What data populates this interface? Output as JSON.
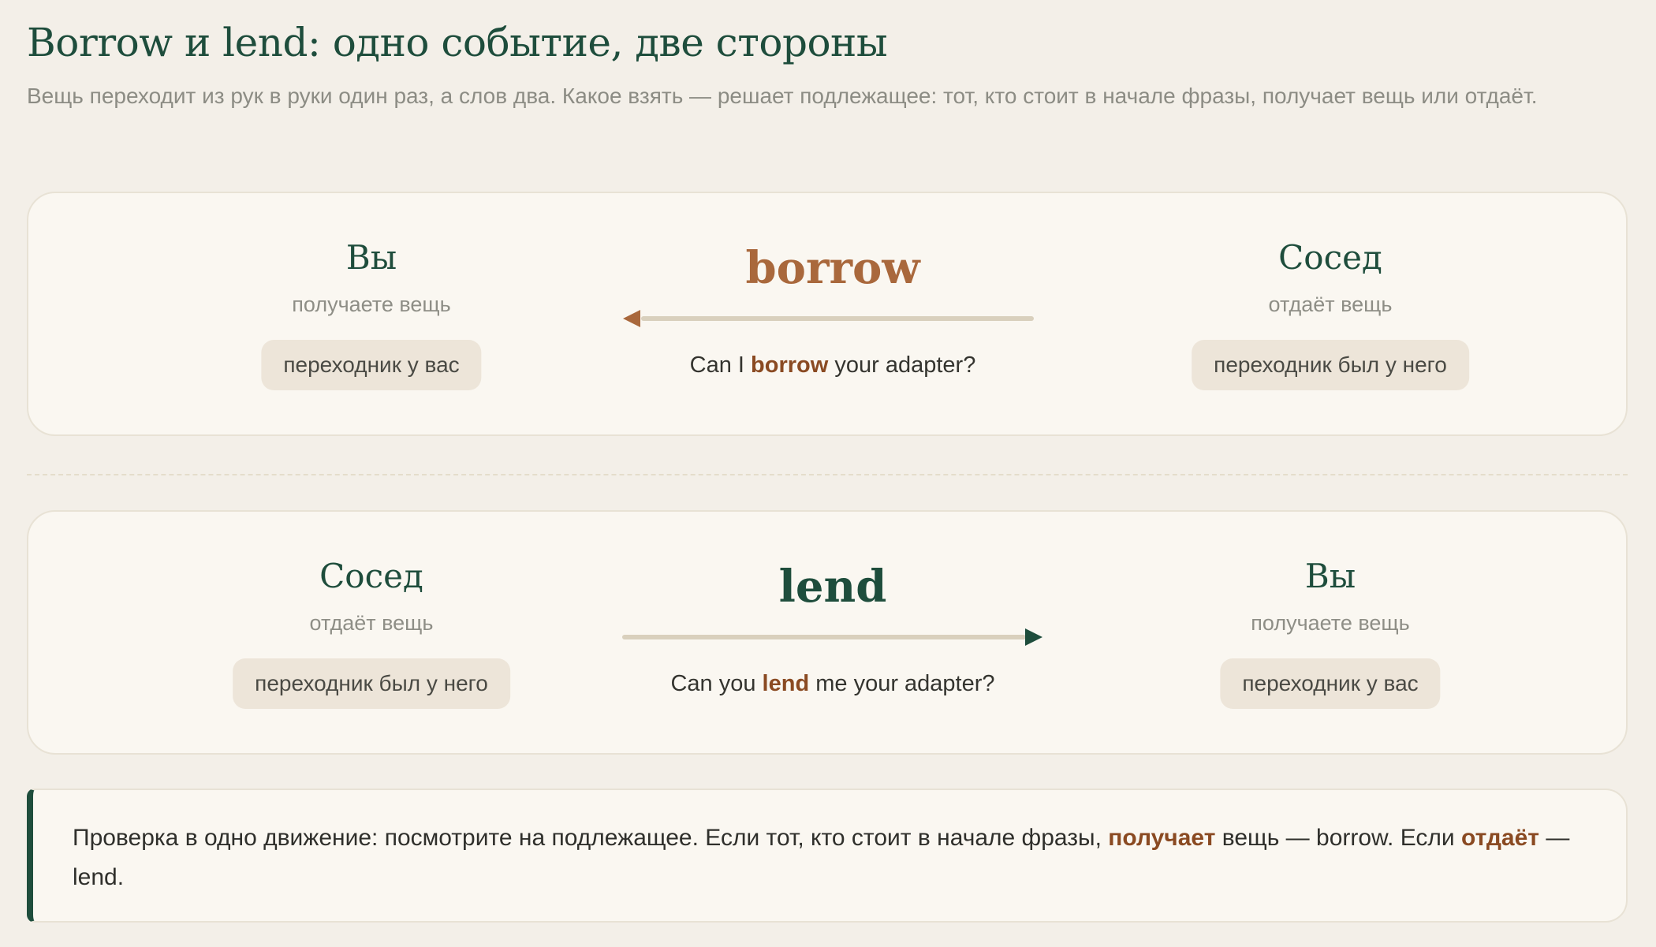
{
  "header": {
    "title": "Borrow и lend: одно событие, две стороны",
    "subtitle": "Вещь переходит из рук в руки один раз, а слов два. Какое взять — решает подлежащее: тот, кто стоит в начале фразы, получает вещь или отдаёт."
  },
  "cards": {
    "borrow": {
      "left": {
        "name": "Вы",
        "role": "получаете вещь",
        "pill": "переходник у вас"
      },
      "verb": "borrow",
      "arrow_direction": "left",
      "arrow_color": "#a9683c",
      "example": {
        "before": "Can I ",
        "verb": "borrow",
        "after": " your adapter?"
      },
      "right": {
        "name": "Сосед",
        "role": "отдаёт вещь",
        "pill": "переходник был у него"
      }
    },
    "lend": {
      "left": {
        "name": "Сосед",
        "role": "отдаёт вещь",
        "pill": "переходник был у него"
      },
      "verb": "lend",
      "arrow_direction": "right",
      "arrow_color": "#1e4d3c",
      "example": {
        "before": "Can you ",
        "verb": "lend",
        "after": " me your adapter?"
      },
      "right": {
        "name": "Вы",
        "role": "получаете вещь",
        "pill": "переходник у вас"
      }
    }
  },
  "note": {
    "part1": "Проверка в одно движение: посмотрите на подлежащее. Если тот, кто стоит в начале фразы, ",
    "strong1": "получает",
    "part2": " вещь — borrow. Если ",
    "strong2": "отдаёт",
    "part3": " — lend."
  },
  "colors": {
    "background": "#f3efe8",
    "card": "#faf7f1",
    "green": "#1e4d3c",
    "brown": "#a9683c",
    "emphasis": "#8a4a22",
    "pill": "#ede5d9",
    "arrow_line": "#d9d0bd"
  }
}
